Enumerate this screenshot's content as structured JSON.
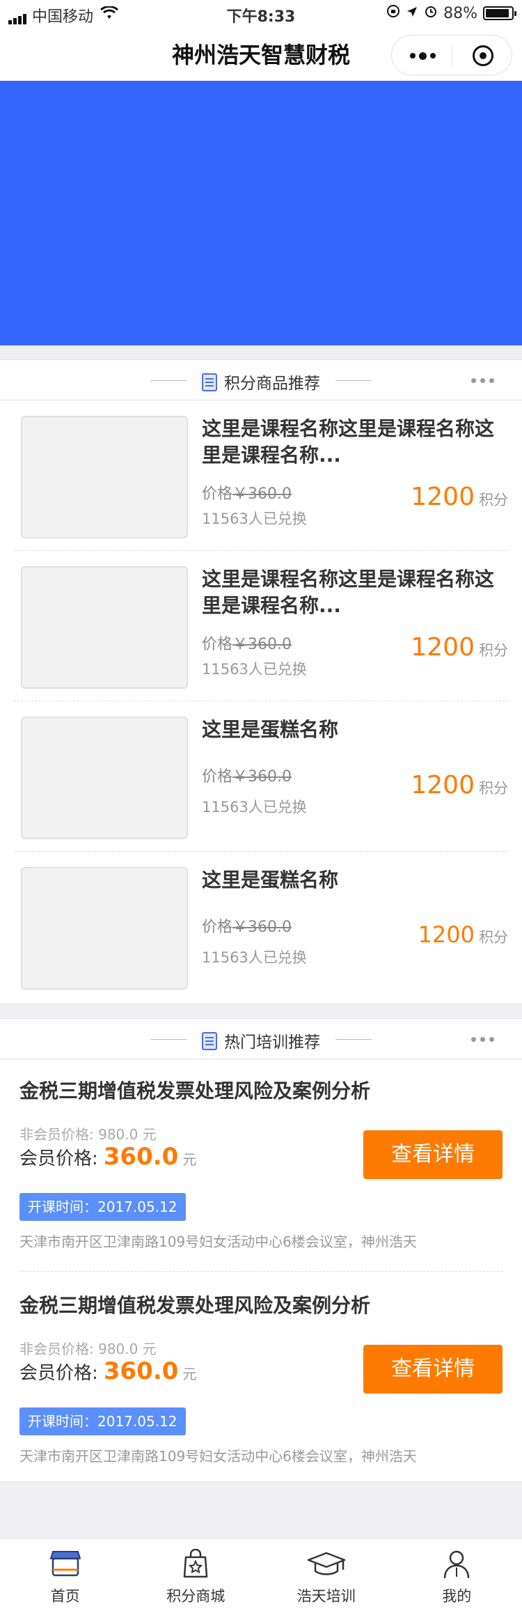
{
  "status_bar": {
    "carrier": "中国移动",
    "time": "下午8:33",
    "battery": "88%",
    "battery_level": 0.88
  },
  "navbar": {
    "title": "神州浩天智慧财税"
  },
  "points_section": {
    "title": "积分商品推荐",
    "items": [
      {
        "name": "这里是课程名称这里是课程名称这里是课程名称...",
        "price_label": "价格",
        "original_price": "￥360.0",
        "sold": "11563人已兑换",
        "points": "1200",
        "points_unit": "积分"
      },
      {
        "name": "这里是课程名称这里是课程名称这里是课程名称...",
        "price_label": "价格",
        "original_price": "￥360.0",
        "sold": "11563人已兑换",
        "points": "1200",
        "points_unit": "积分"
      },
      {
        "name": "这里是蛋糕名称",
        "price_label": "价格",
        "original_price": "￥360.0",
        "sold": "11563人已兑换",
        "points": "1200",
        "points_unit": "积分"
      },
      {
        "name": "这里是蛋糕名称",
        "price_label": "价格",
        "original_price": "￥360.0",
        "sold": "11563人已兑换",
        "points": "1200",
        "points_unit": "积分"
      }
    ]
  },
  "training_section": {
    "title": "热门培训推荐",
    "courses": [
      {
        "title": "金税三期增值税发票处理风险及案例分析",
        "nonmember_price": "非会员价格: 980.0 元",
        "member_label": "会员价格:",
        "member_price": "360.0",
        "currency": "元",
        "button": "查看详情",
        "start_time": "开课时间：2017.05.12",
        "address": "天津市南开区卫津南路109号妇女活动中心6楼会议室，神州浩天"
      },
      {
        "title": "金税三期增值税发票处理风险及案例分析",
        "nonmember_price": "非会员价格: 980.0 元",
        "member_label": "会员价格:",
        "member_price": "360.0",
        "currency": "元",
        "button": "查看详情",
        "start_time": "开课时间：2017.05.12",
        "address": "天津市南开区卫津南路109号妇女活动中心6楼会议室，神州浩天"
      }
    ]
  },
  "tabbar": {
    "items": [
      {
        "label": "首页",
        "icon": "home-store-icon"
      },
      {
        "label": "积分商城",
        "icon": "shopping-bag-icon"
      },
      {
        "label": "浩天培训",
        "icon": "graduation-cap-icon"
      },
      {
        "label": "我的",
        "icon": "user-icon"
      }
    ]
  },
  "colors": {
    "banner": "#3366ff",
    "accent": "#ff7a00",
    "badge": "#5b8ff9"
  }
}
